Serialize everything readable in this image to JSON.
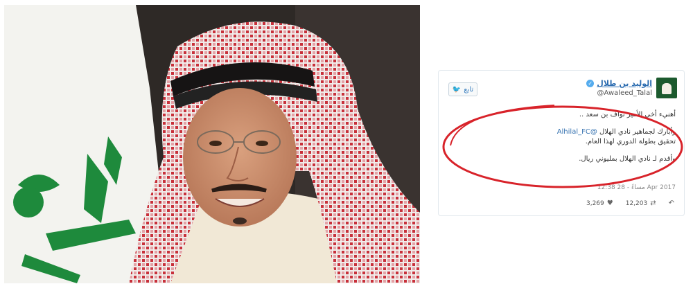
{
  "tweet": {
    "follow_label": "تابع",
    "author_name": "الوليد بن طلال",
    "author_handle": "@Awaleed_Talal",
    "lines": [
      "أهنيء أخي الأمير نواف بن سعد ..",
      "وأبارك لجماهير نادي الهلال",
      "تحقيق بطولة الدوري لهذا العام.",
      "وأقدم لـ نادي الهلال بمليوني ريال."
    ],
    "mention": "@Alhilal_FC",
    "time": "12:38 مساءً - 28 Apr 2017",
    "likes": "3,269",
    "retweets": "12,203"
  },
  "icons": {
    "follow": "twitter-bird-icon",
    "verified": "verified-badge-icon",
    "like": "heart-icon",
    "retweet": "retweet-icon",
    "reply": "reply-icon"
  },
  "colors": {
    "link": "#2b6cb0",
    "twitter_blue": "#55acee",
    "annotation_red": "#d8232a",
    "scarf_red": "#c8303a"
  }
}
